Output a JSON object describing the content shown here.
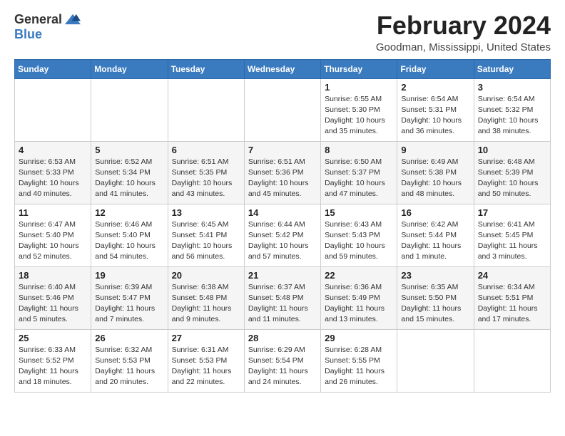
{
  "logo": {
    "general": "General",
    "blue": "Blue"
  },
  "title": "February 2024",
  "location": "Goodman, Mississippi, United States",
  "days_of_week": [
    "Sunday",
    "Monday",
    "Tuesday",
    "Wednesday",
    "Thursday",
    "Friday",
    "Saturday"
  ],
  "weeks": [
    [
      {
        "day": "",
        "info": ""
      },
      {
        "day": "",
        "info": ""
      },
      {
        "day": "",
        "info": ""
      },
      {
        "day": "",
        "info": ""
      },
      {
        "day": "1",
        "info": "Sunrise: 6:55 AM\nSunset: 5:30 PM\nDaylight: 10 hours\nand 35 minutes."
      },
      {
        "day": "2",
        "info": "Sunrise: 6:54 AM\nSunset: 5:31 PM\nDaylight: 10 hours\nand 36 minutes."
      },
      {
        "day": "3",
        "info": "Sunrise: 6:54 AM\nSunset: 5:32 PM\nDaylight: 10 hours\nand 38 minutes."
      }
    ],
    [
      {
        "day": "4",
        "info": "Sunrise: 6:53 AM\nSunset: 5:33 PM\nDaylight: 10 hours\nand 40 minutes."
      },
      {
        "day": "5",
        "info": "Sunrise: 6:52 AM\nSunset: 5:34 PM\nDaylight: 10 hours\nand 41 minutes."
      },
      {
        "day": "6",
        "info": "Sunrise: 6:51 AM\nSunset: 5:35 PM\nDaylight: 10 hours\nand 43 minutes."
      },
      {
        "day": "7",
        "info": "Sunrise: 6:51 AM\nSunset: 5:36 PM\nDaylight: 10 hours\nand 45 minutes."
      },
      {
        "day": "8",
        "info": "Sunrise: 6:50 AM\nSunset: 5:37 PM\nDaylight: 10 hours\nand 47 minutes."
      },
      {
        "day": "9",
        "info": "Sunrise: 6:49 AM\nSunset: 5:38 PM\nDaylight: 10 hours\nand 48 minutes."
      },
      {
        "day": "10",
        "info": "Sunrise: 6:48 AM\nSunset: 5:39 PM\nDaylight: 10 hours\nand 50 minutes."
      }
    ],
    [
      {
        "day": "11",
        "info": "Sunrise: 6:47 AM\nSunset: 5:40 PM\nDaylight: 10 hours\nand 52 minutes."
      },
      {
        "day": "12",
        "info": "Sunrise: 6:46 AM\nSunset: 5:40 PM\nDaylight: 10 hours\nand 54 minutes."
      },
      {
        "day": "13",
        "info": "Sunrise: 6:45 AM\nSunset: 5:41 PM\nDaylight: 10 hours\nand 56 minutes."
      },
      {
        "day": "14",
        "info": "Sunrise: 6:44 AM\nSunset: 5:42 PM\nDaylight: 10 hours\nand 57 minutes."
      },
      {
        "day": "15",
        "info": "Sunrise: 6:43 AM\nSunset: 5:43 PM\nDaylight: 10 hours\nand 59 minutes."
      },
      {
        "day": "16",
        "info": "Sunrise: 6:42 AM\nSunset: 5:44 PM\nDaylight: 11 hours\nand 1 minute."
      },
      {
        "day": "17",
        "info": "Sunrise: 6:41 AM\nSunset: 5:45 PM\nDaylight: 11 hours\nand 3 minutes."
      }
    ],
    [
      {
        "day": "18",
        "info": "Sunrise: 6:40 AM\nSunset: 5:46 PM\nDaylight: 11 hours\nand 5 minutes."
      },
      {
        "day": "19",
        "info": "Sunrise: 6:39 AM\nSunset: 5:47 PM\nDaylight: 11 hours\nand 7 minutes."
      },
      {
        "day": "20",
        "info": "Sunrise: 6:38 AM\nSunset: 5:48 PM\nDaylight: 11 hours\nand 9 minutes."
      },
      {
        "day": "21",
        "info": "Sunrise: 6:37 AM\nSunset: 5:48 PM\nDaylight: 11 hours\nand 11 minutes."
      },
      {
        "day": "22",
        "info": "Sunrise: 6:36 AM\nSunset: 5:49 PM\nDaylight: 11 hours\nand 13 minutes."
      },
      {
        "day": "23",
        "info": "Sunrise: 6:35 AM\nSunset: 5:50 PM\nDaylight: 11 hours\nand 15 minutes."
      },
      {
        "day": "24",
        "info": "Sunrise: 6:34 AM\nSunset: 5:51 PM\nDaylight: 11 hours\nand 17 minutes."
      }
    ],
    [
      {
        "day": "25",
        "info": "Sunrise: 6:33 AM\nSunset: 5:52 PM\nDaylight: 11 hours\nand 18 minutes."
      },
      {
        "day": "26",
        "info": "Sunrise: 6:32 AM\nSunset: 5:53 PM\nDaylight: 11 hours\nand 20 minutes."
      },
      {
        "day": "27",
        "info": "Sunrise: 6:31 AM\nSunset: 5:53 PM\nDaylight: 11 hours\nand 22 minutes."
      },
      {
        "day": "28",
        "info": "Sunrise: 6:29 AM\nSunset: 5:54 PM\nDaylight: 11 hours\nand 24 minutes."
      },
      {
        "day": "29",
        "info": "Sunrise: 6:28 AM\nSunset: 5:55 PM\nDaylight: 11 hours\nand 26 minutes."
      },
      {
        "day": "",
        "info": ""
      },
      {
        "day": "",
        "info": ""
      }
    ]
  ]
}
